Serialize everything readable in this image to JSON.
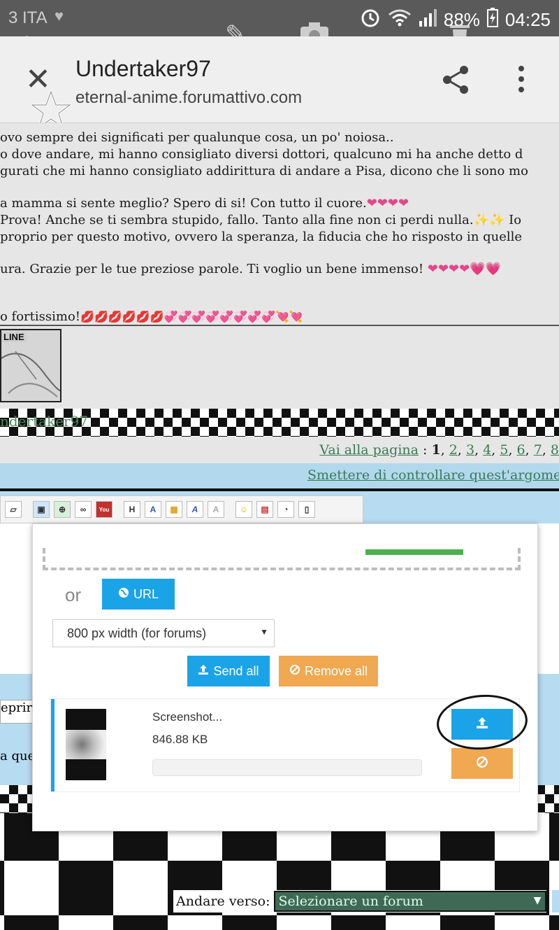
{
  "status_bar": {
    "carrier": "3 ITA",
    "battery": "88%",
    "time": "04:25"
  },
  "header": {
    "title": "Undertaker97",
    "url": "eternal-anime.forumattivo.com"
  },
  "post": {
    "lines": [
      "ovo sempre dei significati per qualunque cosa, un po' noiosa..",
      "o dove andare, mi hanno consigliato diversi dottori, qualcuno mi ha anche detto d",
      "gurati che mi hanno consigliato addirittura di andare a Pisa, dicono che li sono mo",
      "a mamma si sente meglio? Spero di si! Con tutto il cuore.",
      "Prova! Anche se ti sembra stupido, fallo. Tanto alla fine non ci perdi nulla.",
      "proprio per questo motivo, ovvero la speranza, la fiducia che ho risposto in quelle",
      "ura. Grazie per le tue preziose parole. Ti voglio un bene immenso!",
      "o fortissimo!"
    ],
    "line5_tail": "Io",
    "hearts_line4": "❤❤❤❤",
    "sparkles_line5": "✨✨",
    "hearts_line7": "❤❤❤❤💗💗",
    "kisses_line8": "💋💋💋💋💋💋💞💞💞💞💞💞💞💞💘💘"
  },
  "avatar": {
    "badge": "LINE"
  },
  "username_strip": "ndertaker97",
  "pager": {
    "label": "Vai alla pagina",
    "colon": " : ",
    "current": "1",
    "pages": [
      "2",
      "3",
      "4",
      "5",
      "6",
      "7",
      "8"
    ]
  },
  "watch_link": "Smettere di controllare quest'argome",
  "editor": {
    "toolbar_icons": [
      "edit",
      "image",
      "image-upload",
      "link",
      "youtube",
      "H",
      "font",
      "color",
      "A",
      "clear",
      "smiley",
      "calendar",
      "chart",
      "page"
    ]
  },
  "side_fragments": {
    "frag1": "eprir",
    "frag2": "a que"
  },
  "goto": {
    "label": "Andare verso:",
    "selected": "Selezionare un forum"
  },
  "uploader": {
    "or_label": "or",
    "url_button": "URL",
    "size_select": "800 px width (for forums)",
    "send_all": "Send all",
    "remove_all": "Remove all",
    "file": {
      "name": "Screenshot...",
      "size": "846.88 KB"
    }
  },
  "colors": {
    "primary_blue": "#1ba3e8",
    "orange": "#f0a851",
    "progress_green": "#4caf50",
    "forum_green": "#3a7a55",
    "watch_bg": "#b2d8ee"
  }
}
